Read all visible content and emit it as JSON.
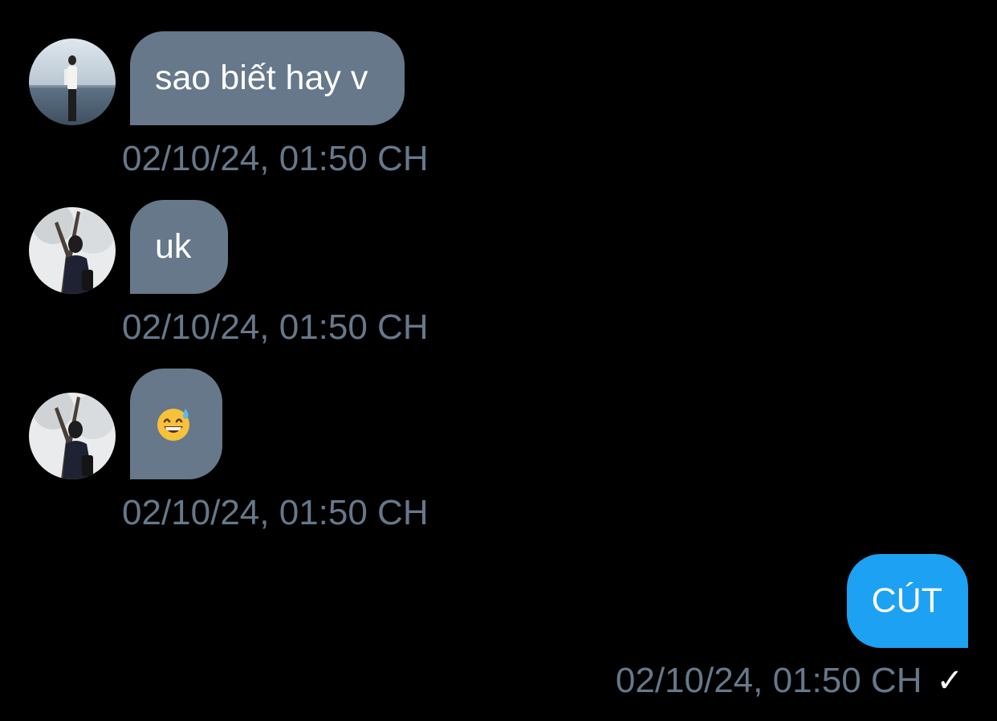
{
  "conversation": {
    "messages": [
      {
        "direction": "incoming",
        "text": "sao biết hay v",
        "timestamp": "02/10/24, 01:50 CH",
        "avatar": "sender-photo-seaside"
      },
      {
        "direction": "incoming",
        "text": "uk",
        "timestamp": "02/10/24, 01:50 CH",
        "avatar": "sender-photo-tree"
      },
      {
        "direction": "incoming",
        "text": "",
        "emoji": "grinning-face-with-sweat-icon",
        "timestamp": "02/10/24, 01:50 CH",
        "avatar": "sender-photo-tree"
      },
      {
        "direction": "outgoing",
        "text": "CÚT",
        "timestamp": "02/10/24, 01:50 CH",
        "status_icon": "checkmark-icon",
        "status_glyph": "✓"
      }
    ]
  },
  "colors": {
    "background": "#000000",
    "incoming_bubble": "#66788a",
    "outgoing_bubble": "#1da1f2",
    "timestamp": "#66788a",
    "text": "#ffffff"
  }
}
